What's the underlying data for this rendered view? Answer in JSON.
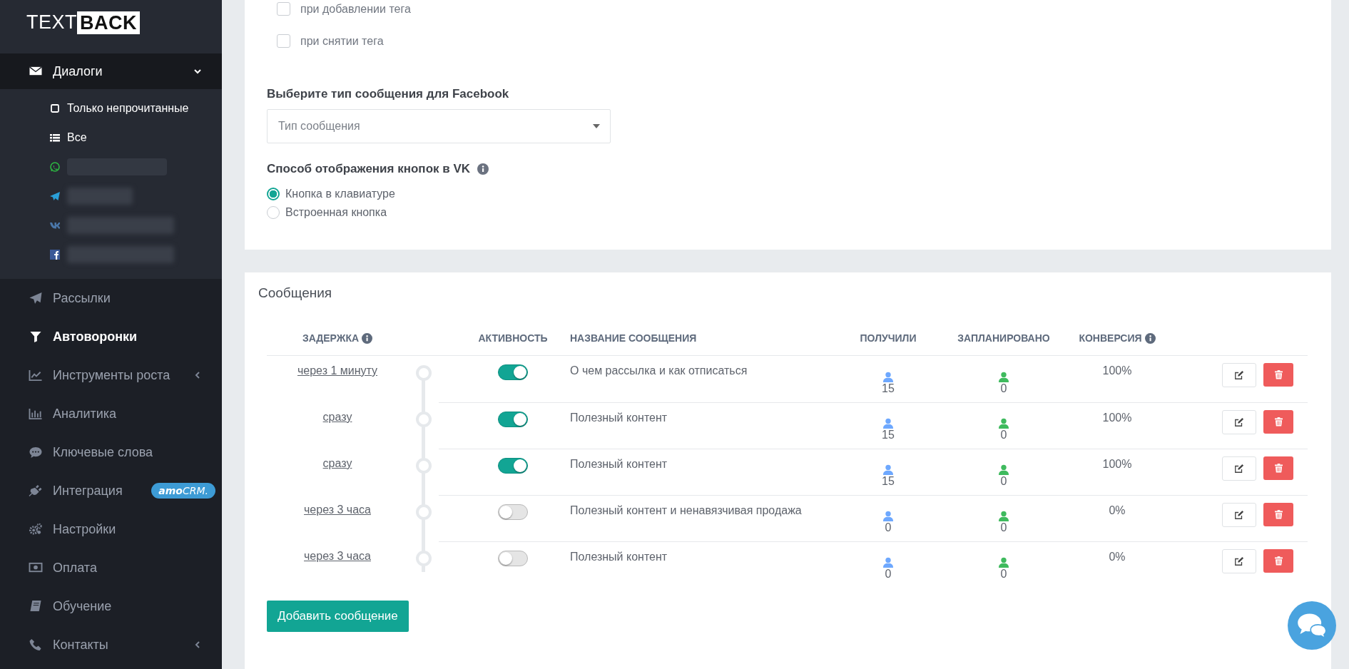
{
  "sidebar": {
    "logo": {
      "plain": "TEXT",
      "boxed": "BACK"
    },
    "nav": [
      {
        "label": "Диалоги",
        "kind": "group",
        "expanded": true,
        "selected": false,
        "children": [
          {
            "kind": "unread",
            "label": "Только непрочитанные"
          },
          {
            "kind": "all",
            "label": "Все"
          },
          {
            "kind": "whatsapp"
          },
          {
            "kind": "telegram"
          },
          {
            "kind": "vk"
          },
          {
            "kind": "facebook"
          }
        ]
      },
      {
        "label": "Рассылки",
        "kind": "link",
        "selected": false
      },
      {
        "label": "Автоворонки",
        "kind": "link",
        "selected": true
      },
      {
        "label": "Инструменты роста",
        "kind": "group",
        "expanded": false,
        "selected": false
      },
      {
        "label": "Аналитика",
        "kind": "link",
        "selected": false
      },
      {
        "label": "Ключевые слова",
        "kind": "link",
        "selected": false
      },
      {
        "label": "Интеграция",
        "kind": "link",
        "selected": false,
        "badge": "**amo**CRM."
      },
      {
        "label": "Настройки",
        "kind": "link",
        "selected": false
      },
      {
        "label": "Оплата",
        "kind": "link",
        "selected": false
      },
      {
        "label": "Обучение",
        "kind": "link",
        "selected": false
      },
      {
        "label": "Контакты",
        "kind": "group",
        "expanded": false,
        "selected": false
      }
    ]
  },
  "settings": {
    "checkboxes": [
      {
        "label": "при добавлении тега",
        "checked": false
      },
      {
        "label": "при снятии тега",
        "checked": false
      }
    ],
    "facebook_type": {
      "heading": "Выберите тип сообщения для Facebook",
      "placeholder": "Тип сообщения"
    },
    "vk_buttons": {
      "heading": "Способ отображения кнопок в VK",
      "options": [
        {
          "label": "Кнопка в клавиатуре",
          "selected": true
        },
        {
          "label": "Встроенная кнопка",
          "selected": false
        }
      ]
    }
  },
  "messages": {
    "title": "Сообщения",
    "columns": [
      "ЗАДЕРЖКА",
      "АКТИВНОСТЬ",
      "НАЗВАНИЕ СООБЩЕНИЯ",
      "ПОЛУЧИЛИ",
      "ЗАПЛАНИРОВАНО",
      "КОНВЕРСИЯ"
    ],
    "rows": [
      {
        "delay": "через 1 минуту",
        "active": true,
        "name": "О чем рассылка и как отписаться",
        "received": "15",
        "planned": "0",
        "conversion": "100%"
      },
      {
        "delay": "сразу",
        "active": true,
        "name": "Полезный контент",
        "received": "15",
        "planned": "0",
        "conversion": "100%"
      },
      {
        "delay": "сразу",
        "active": true,
        "name": "Полезный контент",
        "received": "15",
        "planned": "0",
        "conversion": "100%"
      },
      {
        "delay": "через 3 часа",
        "active": false,
        "name": "Полезный контент и ненавязчивая продажа",
        "received": "0",
        "planned": "0",
        "conversion": "0%"
      },
      {
        "delay": "через 3 часа",
        "active": false,
        "name": "Полезный контент",
        "received": "0",
        "planned": "0",
        "conversion": "0%"
      }
    ],
    "add_button": "Добавить сообщение"
  }
}
